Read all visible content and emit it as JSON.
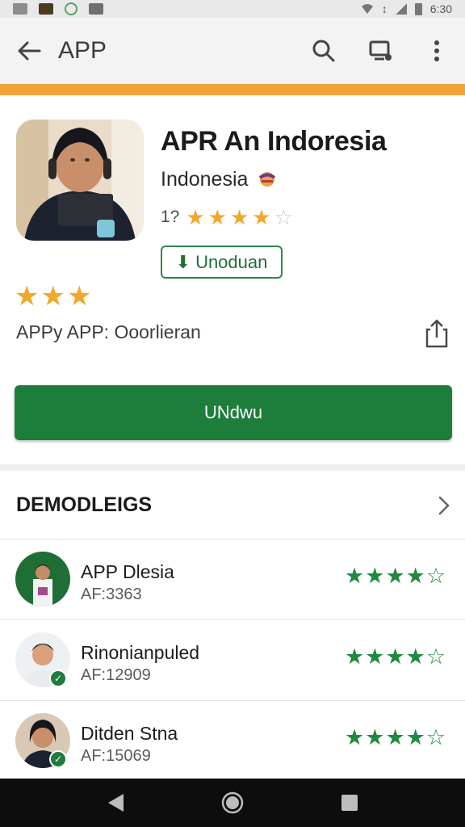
{
  "status_bar": {
    "time": "6:30"
  },
  "app_bar": {
    "title": "APP"
  },
  "app": {
    "name": "APR An Indoresia",
    "subtitle": "Indonesia",
    "rating_label": "1?",
    "rating_stars": 3.5,
    "download_chip": "Unoduan",
    "overall_stars": 3,
    "byline": "APPy APP: Ooorlieran",
    "install_label": "UNdwu"
  },
  "section": {
    "title": "DEMODLEIGS",
    "items": [
      {
        "name": "APP Dlesia",
        "meta": "AF:3363",
        "stars": 4
      },
      {
        "name": "Rinonianpuled",
        "meta": "AF:12909",
        "stars": 4
      },
      {
        "name": "Ditden Stna",
        "meta": "AF:15069",
        "stars": 4
      }
    ]
  },
  "colors": {
    "accent": "#f0a33a",
    "primary_green": "#1d7d3a",
    "star_gold": "#f2a72c"
  }
}
